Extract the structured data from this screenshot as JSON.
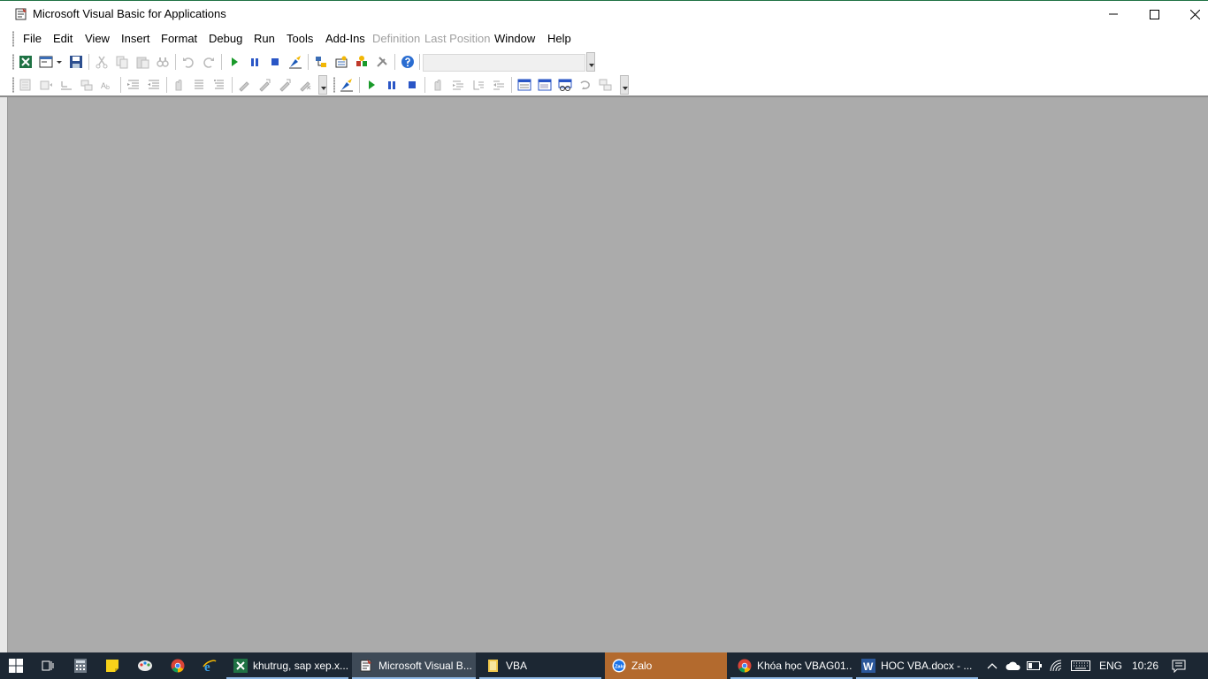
{
  "window": {
    "title": "Microsoft Visual Basic for Applications",
    "controls": {
      "minimize": "minimize",
      "maximize": "maximize",
      "close": "close"
    }
  },
  "menu": {
    "items": [
      {
        "label": "File"
      },
      {
        "label": "Edit"
      },
      {
        "label": "View"
      },
      {
        "label": "Insert"
      },
      {
        "label": "Format"
      },
      {
        "label": "Debug"
      },
      {
        "label": "Run"
      },
      {
        "label": "Tools"
      },
      {
        "label": "Add-Ins"
      },
      {
        "label": "Definition"
      },
      {
        "label": "Last Position"
      },
      {
        "label": "Window"
      },
      {
        "label": "Help"
      }
    ]
  },
  "toolbar_standard": {
    "icons": [
      "view-excel-icon",
      "insert-userform-icon",
      "save-icon",
      "cut-icon",
      "copy-icon",
      "paste-icon",
      "find-icon",
      "undo-icon",
      "redo-icon",
      "run-icon",
      "break-icon",
      "reset-icon",
      "design-mode-icon",
      "project-explorer-icon",
      "properties-icon",
      "object-browser-icon",
      "toolbox-icon",
      "help-icon"
    ]
  },
  "toolbar_edit": {
    "icons": [
      "list-properties-icon",
      "list-constants-icon",
      "quick-info-icon",
      "parameter-info-icon",
      "complete-word-icon",
      "indent-icon",
      "outdent-icon",
      "toggle-breakpoint-icon",
      "comment-block-icon",
      "uncomment-block-icon",
      "toggle-bookmark-icon",
      "next-bookmark-icon",
      "previous-bookmark-icon",
      "clear-bookmarks-icon"
    ]
  },
  "toolbar_debug": {
    "icons": [
      "design-mode-icon",
      "run-icon",
      "break-icon",
      "reset-icon",
      "toggle-breakpoint-icon",
      "step-into-icon",
      "step-over-icon",
      "step-out-icon",
      "locals-window-icon",
      "immediate-window-icon",
      "watch-window-icon",
      "quick-watch-icon",
      "call-stack-icon"
    ]
  },
  "taskbar": {
    "apps": [
      {
        "label": "khutrug, sap xep.x..."
      },
      {
        "label": "Microsoft Visual B..."
      },
      {
        "label": "VBA"
      },
      {
        "label": "Zalo"
      },
      {
        "label": "Khóa học VBAG01..."
      },
      {
        "label": "HOC VBA.docx - ..."
      }
    ],
    "language": "ENG",
    "time": "10:26"
  },
  "colors": {
    "workspace": "#ababab",
    "taskbar": "#1c2733",
    "excel_green": "#1f7244",
    "zalo_orange": "#b36a2e"
  }
}
